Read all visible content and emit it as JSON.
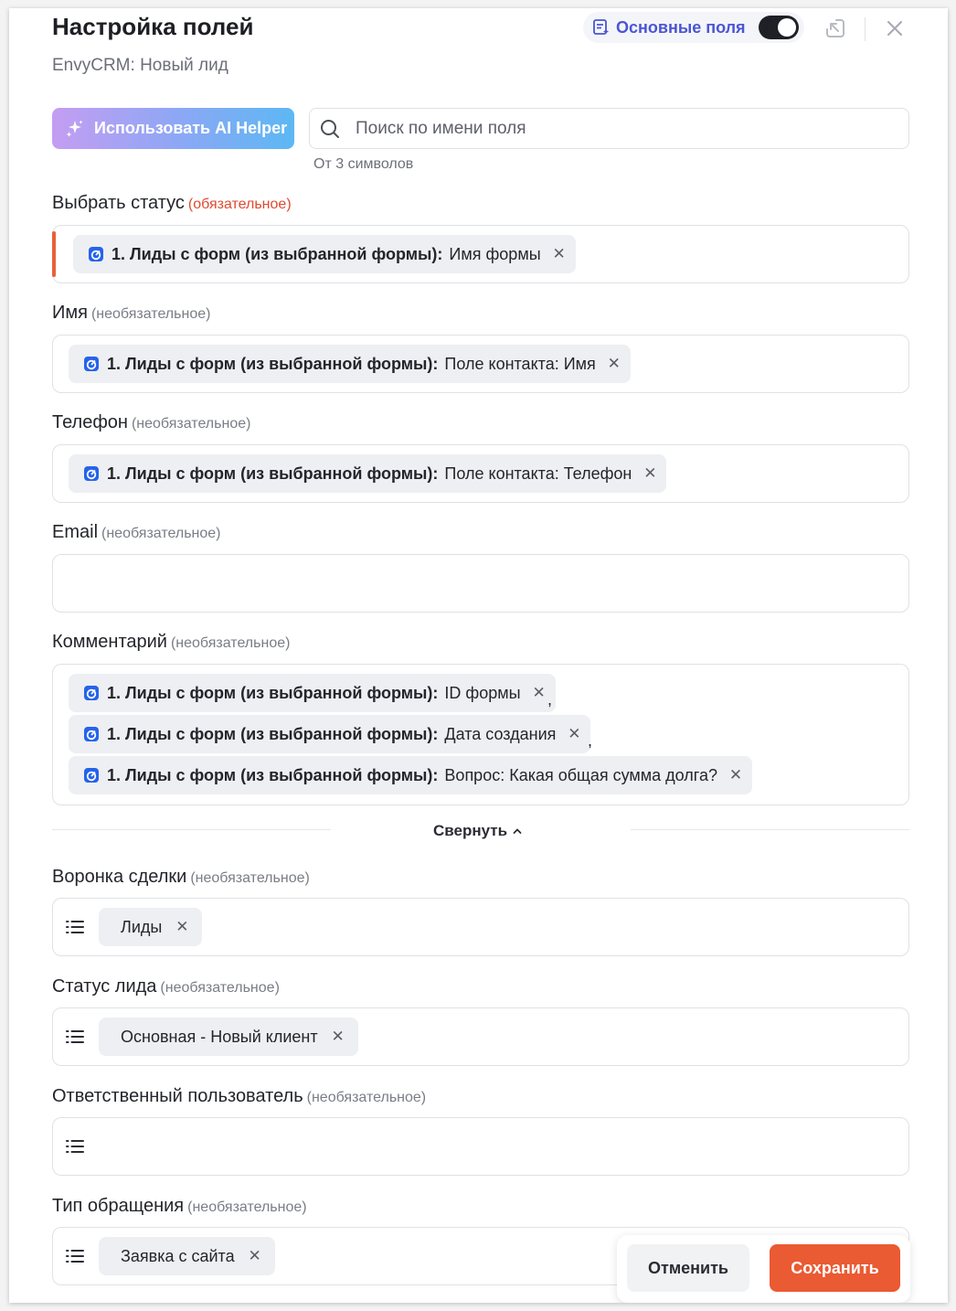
{
  "header": {
    "title": "Настройка полей",
    "subtitle": "EnvyCRM: Новый лид",
    "main_fields_label": "Основные поля",
    "main_fields_on": true
  },
  "toolbar": {
    "ai_button_label": "Использовать AI Helper",
    "search_placeholder": "Поиск по имени поля",
    "search_value": "",
    "search_hint": "От 3 символов"
  },
  "tags": {
    "required": "(обязательное)",
    "optional": "(необязательное)"
  },
  "source_label": "1. Лиды с форм (из выбранной формы):",
  "fields": {
    "status": {
      "label": "Выбрать статус",
      "chips": [
        {
          "value": "Имя формы"
        }
      ]
    },
    "name": {
      "label": "Имя",
      "chips": [
        {
          "value": "Поле контакта: Имя"
        }
      ]
    },
    "phone": {
      "label": "Телефон",
      "chips": [
        {
          "value": "Поле контакта: Телефон"
        }
      ]
    },
    "email": {
      "label": "Email",
      "chips": []
    },
    "comment": {
      "label": "Комментарий",
      "chips": [
        {
          "value": "ID формы"
        },
        {
          "value": "Дата создания"
        },
        {
          "value": "Вопрос: Какая общая сумма долга?"
        }
      ],
      "separator": ","
    },
    "funnel": {
      "label": "Воронка сделки",
      "chips": [
        {
          "value": "Лиды"
        }
      ]
    },
    "lead_status": {
      "label": "Статус лида",
      "chips": [
        {
          "value": "Основная - Новый клиент"
        }
      ]
    },
    "responsible": {
      "label": "Ответственный пользователь",
      "chips": []
    },
    "request_type": {
      "label": "Тип обращения",
      "chips": [
        {
          "value": "Заявка с сайта"
        }
      ]
    }
  },
  "collapse_label": "Свернуть",
  "footer": {
    "cancel_label": "Отменить",
    "save_label": "Сохранить"
  },
  "colors": {
    "accent": "#4a55d4",
    "save": "#ea5a33",
    "required": "#e0492f",
    "app_icon": "#2563eb"
  },
  "icons": {
    "main_fields": "form-sparkle-icon",
    "collapse_panel": "collapse-arrow-icon",
    "close": "close-icon",
    "ai": "sparkles-icon",
    "search": "search-icon",
    "app": "app-logo-icon",
    "list": "list-icon",
    "chip_remove": "remove-x-icon",
    "collapse": "chevron-up-icon"
  }
}
